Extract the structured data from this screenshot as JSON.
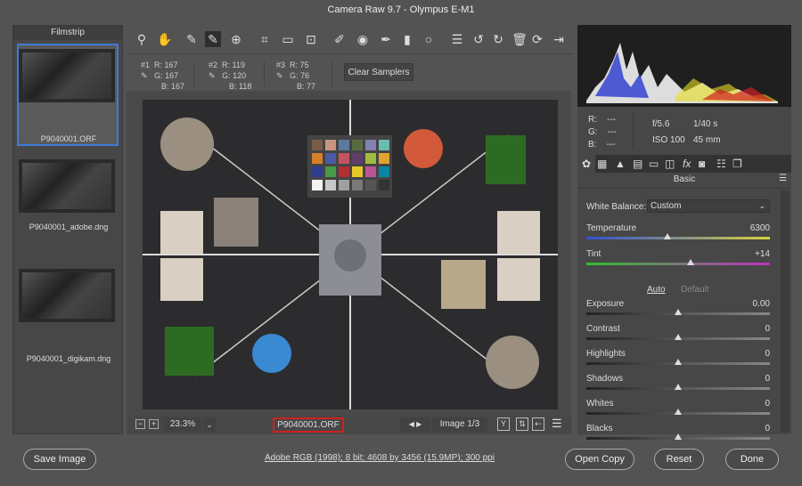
{
  "title": "Camera Raw 9.7  -  Olympus E-M1",
  "filmstrip": {
    "header": "Filmstrip",
    "items": [
      {
        "label": "P9040001.ORF",
        "selected": true
      },
      {
        "label": "P9040001_adobe.dng"
      },
      {
        "label": "P9040001_digikam.dng"
      }
    ]
  },
  "toolbar": {
    "tools": [
      "zoom-icon",
      "hand-icon",
      "white-balance-icon",
      "color-sampler-icon",
      "targeted-adjustment-icon",
      "crop-icon",
      "straighten-icon",
      "transform-icon",
      "spot-removal-icon",
      "red-eye-icon",
      "adjustment-brush-icon",
      "graduated-filter-icon",
      "radial-filter-icon",
      "preferences-icon",
      "rotate-left-icon",
      "rotate-right-icon",
      "trash-icon",
      "sync-icon",
      "fullscreen-icon"
    ]
  },
  "samplers": [
    {
      "id": "#1",
      "r": "R: 167",
      "g": "G: 167",
      "b": "B: 167"
    },
    {
      "id": "#2",
      "r": "R: 119",
      "g": "G: 120",
      "b": "B: 118"
    },
    {
      "id": "#3",
      "r": "R:  75",
      "g": "G:  76",
      "b": "B:  77"
    }
  ],
  "clear_samplers": "Clear Samplers",
  "bottombar": {
    "zoom": "23.3%",
    "filename": "P9040001.ORF",
    "image_counter": "Image 1/3"
  },
  "readout": {
    "r": "R:",
    "g": "G:",
    "b": "B:",
    "rv": "---",
    "gv": "---",
    "bv": "---",
    "aperture": "f/5.6",
    "shutter": "1/40 s",
    "iso": "ISO 100",
    "focal": "45 mm"
  },
  "panel": {
    "title": "Basic",
    "wb_label": "White Balance:",
    "wb_value": "Custom",
    "auto": "Auto",
    "default": "Default",
    "sliders": [
      {
        "label": "Temperature",
        "value": "6300",
        "pos": 0.44
      },
      {
        "label": "Tint",
        "value": "+14",
        "pos": 0.57
      },
      {
        "label": "Exposure",
        "value": "0.00",
        "pos": 0.5
      },
      {
        "label": "Contrast",
        "value": "0",
        "pos": 0.5
      },
      {
        "label": "Highlights",
        "value": "0",
        "pos": 0.5
      },
      {
        "label": "Shadows",
        "value": "0",
        "pos": 0.5
      },
      {
        "label": "Whites",
        "value": "0",
        "pos": 0.5
      },
      {
        "label": "Blacks",
        "value": "0",
        "pos": 0.5
      }
    ]
  },
  "footer": {
    "save": "Save Image",
    "info": "Adobe RGB (1998); 8 bit; 4608 by 3456 (15.9MP); 300 ppi",
    "open": "Open Copy",
    "reset": "Reset",
    "done": "Done"
  },
  "colors": {
    "selected_border": "#3d7bd6",
    "filename_border": "#d0201e"
  }
}
